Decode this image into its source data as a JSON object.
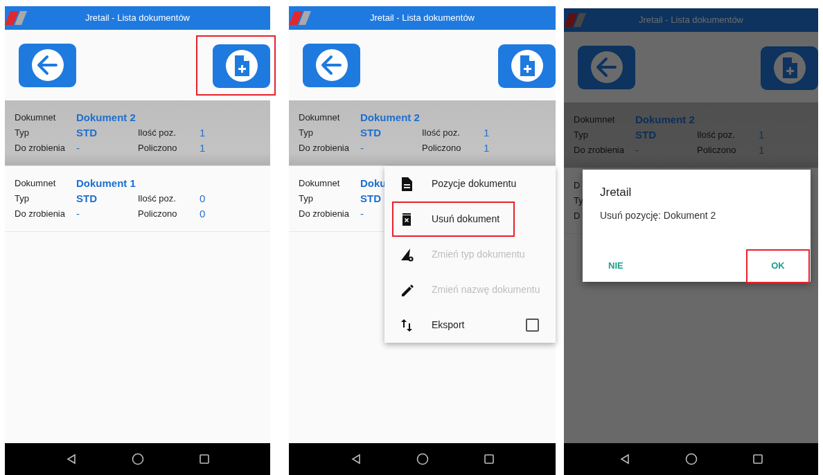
{
  "screens": [
    {
      "title": "Jretail - Lista dokumentów",
      "dimmed": false,
      "add_button": {
        "highlighted": true
      },
      "documents": [
        {
          "selected": true,
          "name_label": "Dokumnet",
          "name": "Dokument 2",
          "type_label": "Typ",
          "type": "STD",
          "count_label": "Ilość poz.",
          "count": "1",
          "todo_label": "Do zrobienia",
          "todo": "-",
          "counted_label": "Policzono",
          "counted": "1"
        },
        {
          "selected": false,
          "name_label": "Dokumnet",
          "name": "Dokument 1",
          "type_label": "Typ",
          "type": "STD",
          "count_label": "Ilość poz.",
          "count": "0",
          "todo_label": "Do zrobienia",
          "todo": "-",
          "counted_label": "Policzono",
          "counted": "0"
        }
      ]
    },
    {
      "title": "Jretail - Lista dokumentów",
      "dimmed": false,
      "add_button": {
        "highlighted": false
      },
      "documents": [
        {
          "selected": true,
          "name_label": "Dokumnet",
          "name": "Dokument 2",
          "type_label": "Typ",
          "type": "STD",
          "count_label": "Ilość poz.",
          "count": "1",
          "todo_label": "Do zrobienia",
          "todo": "-",
          "counted_label": "Policzono",
          "counted": "1"
        },
        {
          "selected": false,
          "name_label": "Dokumnet",
          "name": "Doku",
          "type_label": "Typ",
          "type": "STD",
          "todo_label": "Do zrobienia",
          "todo": "-"
        }
      ],
      "menu": {
        "items": [
          {
            "kind": "action",
            "label": "Pozycje dokumentu",
            "disabled": false,
            "highlighted": false
          },
          {
            "kind": "action",
            "label": "Usuń dokument",
            "disabled": false,
            "highlighted": true
          },
          {
            "kind": "action",
            "label": "Zmień typ dokumentu",
            "disabled": true,
            "highlighted": false
          },
          {
            "kind": "action",
            "label": "Zmień nazwę dokumentu",
            "disabled": true,
            "highlighted": false
          },
          {
            "kind": "checkbox",
            "label": "Eksport",
            "disabled": false,
            "highlighted": false,
            "checked": false
          }
        ]
      }
    },
    {
      "title": "Jretail - Lista dokumentów",
      "dimmed": true,
      "add_button": {
        "highlighted": false
      },
      "documents": [
        {
          "selected": true,
          "name_label": "Dokumnet",
          "name": "Dokument 2",
          "type_label": "Typ",
          "type": "STD",
          "count_label": "Ilość poz.",
          "count": "1",
          "todo_label": "Do zrobienia",
          "todo": "-",
          "counted_label": "Policzono",
          "counted": "1"
        },
        {
          "selected": false,
          "name_label": "D",
          "type_label": "Ty",
          "todo_label": "D"
        }
      ],
      "dialog": {
        "title": "Jretail",
        "message": "Usuń pozycję: Dokument 2",
        "buttons": [
          {
            "label": "NIE",
            "highlighted": false
          },
          {
            "label": "OK",
            "highlighted": true
          }
        ]
      }
    }
  ]
}
